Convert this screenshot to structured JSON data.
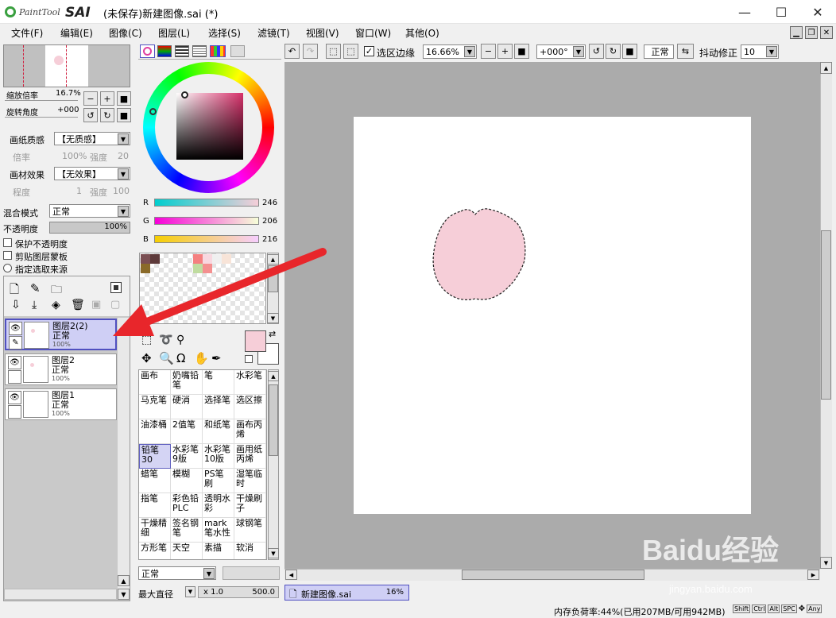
{
  "window": {
    "app_logo": "PaintTool SAI",
    "title": "(未保存)新建图像.sai (*)",
    "buttons": {
      "minimize": "—",
      "maximize": "☐",
      "close": "✕"
    }
  },
  "menu": [
    "文件(F)",
    "编辑(E)",
    "图像(C)",
    "图层(L)",
    "选择(S)",
    "滤镜(T)",
    "视图(V)",
    "窗口(W)",
    "其他(O)"
  ],
  "navigator": {
    "zoom_label": "缩放倍率",
    "zoom_value": "16.7%",
    "rotate_label": "旋转角度",
    "rotate_value": "+000"
  },
  "layer_props": {
    "paper_label": "画纸质感",
    "paper_value": "【无质感】",
    "paper_rate_label": "倍率",
    "paper_rate_value": "100%",
    "paper_strength_label": "强度",
    "paper_strength_value": "20",
    "effect_label": "画材效果",
    "effect_value": "【无效果】",
    "effect_degree_label": "程度",
    "effect_degree_value": "1",
    "effect_strength_label": "强度",
    "effect_strength_value": "100",
    "blend_label": "混合模式",
    "blend_value": "正常",
    "opacity_label": "不透明度",
    "opacity_value": "100%",
    "check_protect": "保护不透明度",
    "check_clip": "剪贴图层蒙板",
    "radio_source": "指定选取来源"
  },
  "layers": [
    {
      "name": "图层2(2)",
      "mode": "正常",
      "opacity": "100%",
      "selected": true
    },
    {
      "name": "图层2",
      "mode": "正常",
      "opacity": "100%",
      "selected": false
    },
    {
      "name": "图层1",
      "mode": "正常",
      "opacity": "100%",
      "selected": false
    }
  ],
  "color": {
    "r_label": "R",
    "r_value": "246",
    "g_label": "G",
    "g_value": "206",
    "b_label": "B",
    "b_value": "216",
    "fg": "#f6ced8",
    "bg": "#ffffff"
  },
  "toolbar": {
    "select_edge_label": "选区边缘",
    "zoom_value": "16.66%",
    "angle_value": "+000°",
    "mode_value": "正常",
    "stabilizer_label": "抖动修正",
    "stabilizer_value": "10"
  },
  "tools": [
    [
      "画布",
      "奶嘴铅笔",
      "笔",
      "水彩笔"
    ],
    [
      "马克笔",
      "硬消",
      "选择笔",
      "选区擦"
    ],
    [
      "油漆桶",
      "2值笔",
      "和纸笔",
      "画布丙烯"
    ],
    [
      "铅笔30",
      "水彩笔9版",
      "水彩笔10版",
      "画用纸丙烯"
    ],
    [
      "蜡笔",
      "模糊",
      "PS笔刷",
      "湿笔临时"
    ],
    [
      "指笔",
      "彩色铅PLC",
      "透明水彩",
      "干燥刷子"
    ],
    [
      "干燥精细",
      "签名钢笔",
      "mark笔水性",
      "球钢笔"
    ],
    [
      "方形笔",
      "天空",
      "素描",
      "软消"
    ]
  ],
  "brush": {
    "mode_value": "正常",
    "max_size_label": "最大直径",
    "max_size_mult": "x 1.0",
    "max_size_value": "500.0"
  },
  "tab": {
    "name": "新建图像.sai",
    "zoom": "16%"
  },
  "status": {
    "memory": "内存负荷率:44%(已用207MB/可用942MB)",
    "keys": [
      "Shift",
      "Ctrl",
      "Alt",
      "SPC",
      "Any"
    ]
  },
  "watermark": {
    "brand": "Baidu经验",
    "url": "jingyan.baidu.com"
  },
  "colors": {
    "accent": "#5050c0",
    "arrow": "#e8262b",
    "shape": "#f6ced8"
  }
}
